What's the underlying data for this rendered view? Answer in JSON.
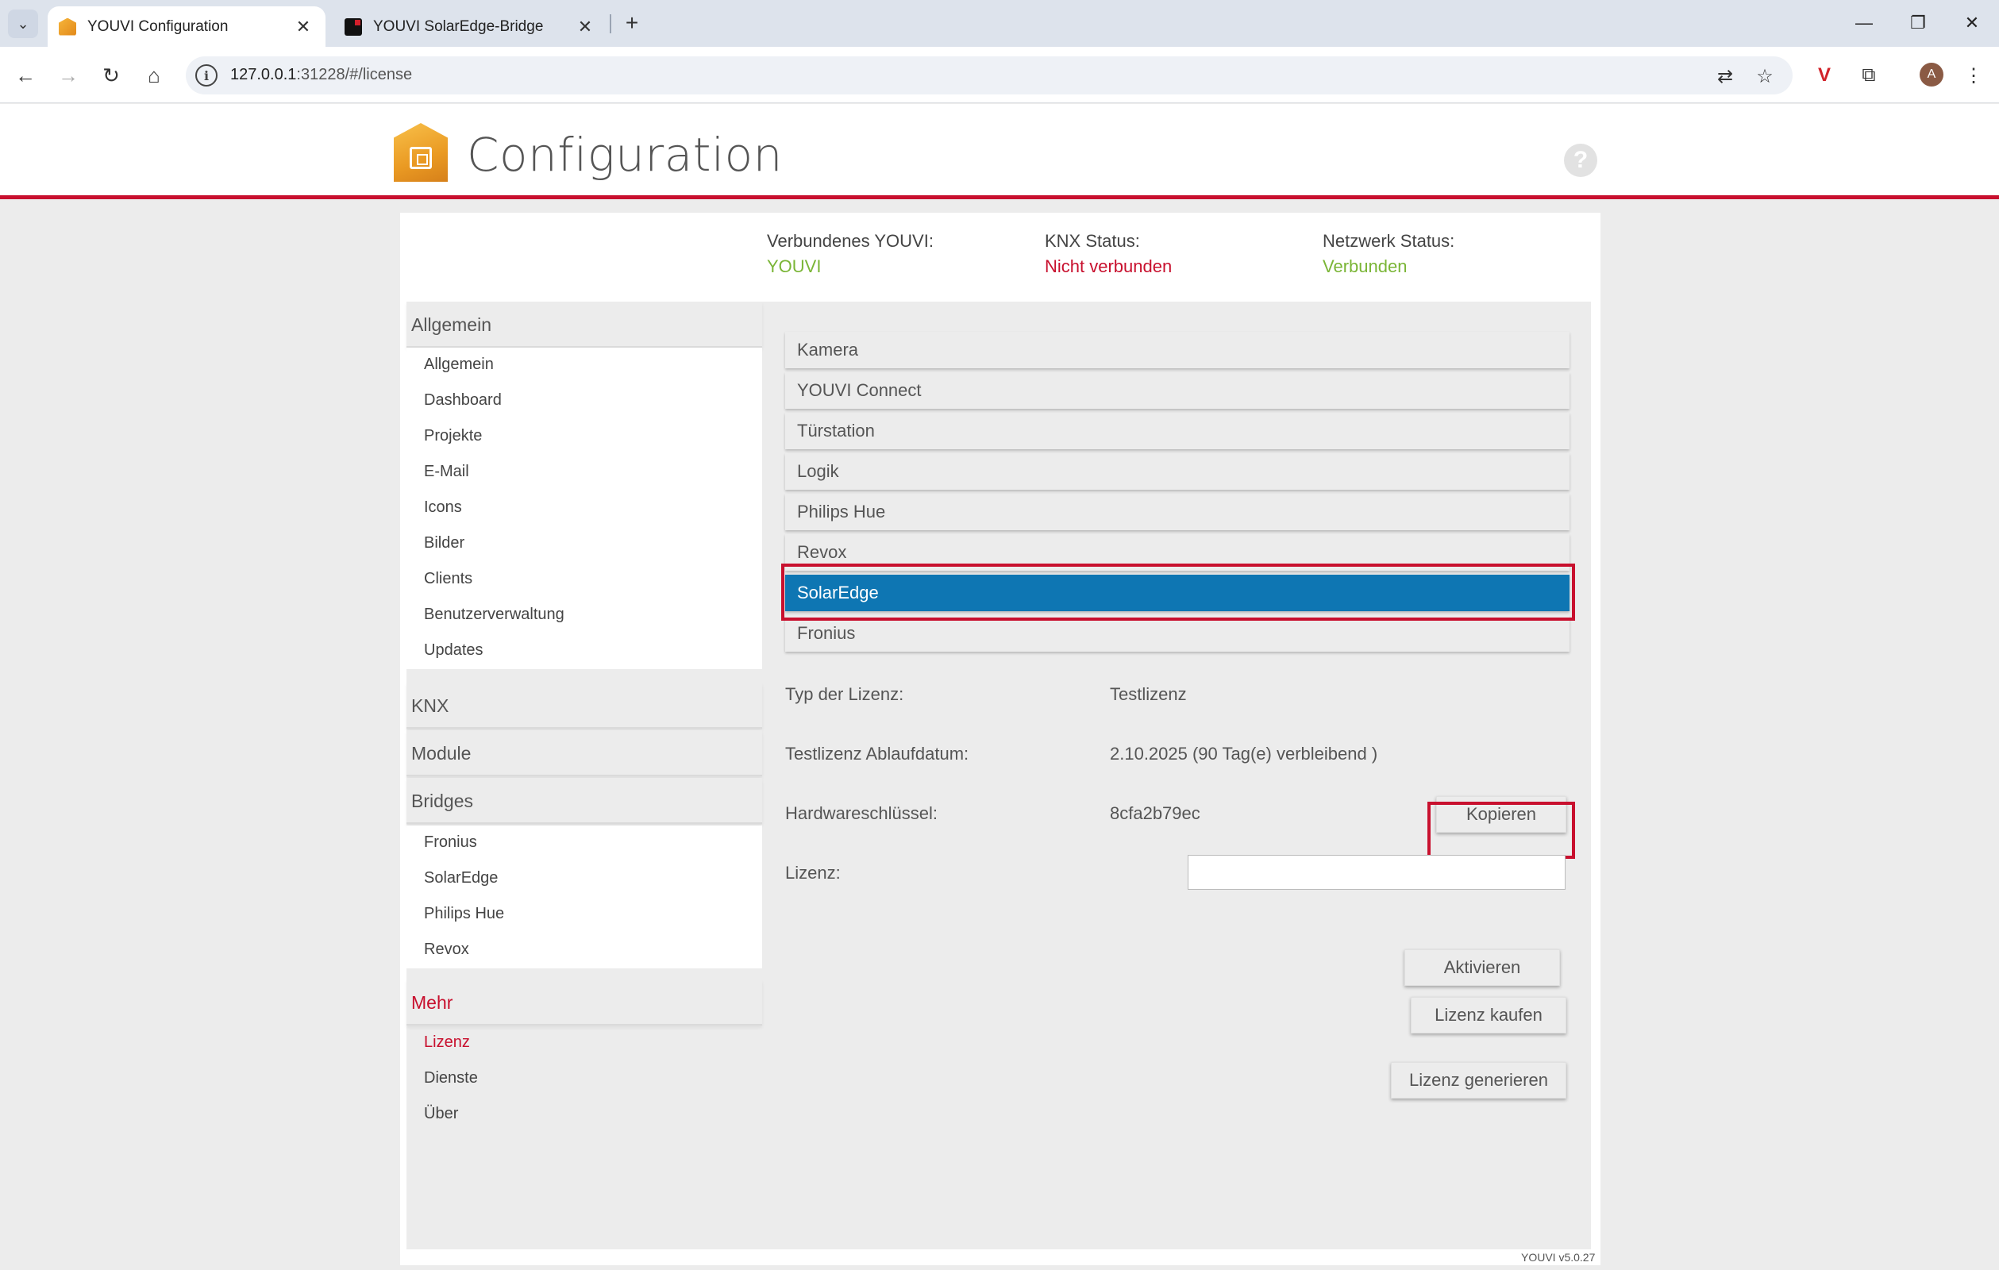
{
  "browser": {
    "tabs": [
      {
        "title": "YOUVI Configuration",
        "active": true
      },
      {
        "title": "YOUVI SolarEdge-Bridge",
        "active": false
      }
    ],
    "url_host": "127.0.0.1",
    "url_rest": ":31228/#/license",
    "icons": [
      "back-icon",
      "forward-icon",
      "reload-icon",
      "home-icon",
      "site-info-icon",
      "translate-icon",
      "bookmark-star-icon",
      "extension-icon",
      "puzzle-icon",
      "menu-dots-icon"
    ],
    "avatar_letter": "A"
  },
  "header": {
    "title": "Configuration",
    "help": "?"
  },
  "status": {
    "youvi": {
      "label": "Verbundenes YOUVI:",
      "value": "YOUVI"
    },
    "knx": {
      "label": "KNX Status:",
      "value": "Nicht verbunden"
    },
    "network": {
      "label": "Netzwerk Status:",
      "value": "Verbunden"
    }
  },
  "sidebar": {
    "general_head": "Allgemein",
    "general_items": [
      "Allgemein",
      "Dashboard",
      "Projekte",
      "E-Mail",
      "Icons",
      "Bilder",
      "Clients",
      "Benutzerverwaltung",
      "Updates"
    ],
    "knx_head": "KNX",
    "module_head": "Module",
    "bridges_head": "Bridges",
    "bridges_items": [
      "Fronius",
      "SolarEdge",
      "Philips Hue",
      "Revox"
    ],
    "more_head": "Mehr",
    "more_items": [
      "Lizenz",
      "Dienste",
      "Über"
    ]
  },
  "modules": [
    "Kamera",
    "YOUVI Connect",
    "Türstation",
    "Logik",
    "Philips Hue",
    "Revox",
    "SolarEdge",
    "Fronius"
  ],
  "selected_module": "SolarEdge",
  "license": {
    "type_label": "Typ der Lizenz:",
    "type_value": "Testlizenz",
    "expiry_label": "Testlizenz Ablaufdatum:",
    "expiry_value": "2.10.2025 (90 Tag(e) verbleibend )",
    "hw_label": "Hardwareschlüssel:",
    "hw_value": "8cfa2b79ec",
    "copy_button": "Kopieren",
    "license_label": "Lizenz:",
    "license_input_value": "",
    "activate_button": "Aktivieren",
    "buy_button": "Lizenz kaufen",
    "generate_button": "Lizenz generieren"
  },
  "footer": {
    "version": "YOUVI v5.0.27"
  },
  "colors": {
    "accent_red": "#c8102e",
    "selected_blue": "#0e76b3",
    "status_green": "#7ab536"
  }
}
